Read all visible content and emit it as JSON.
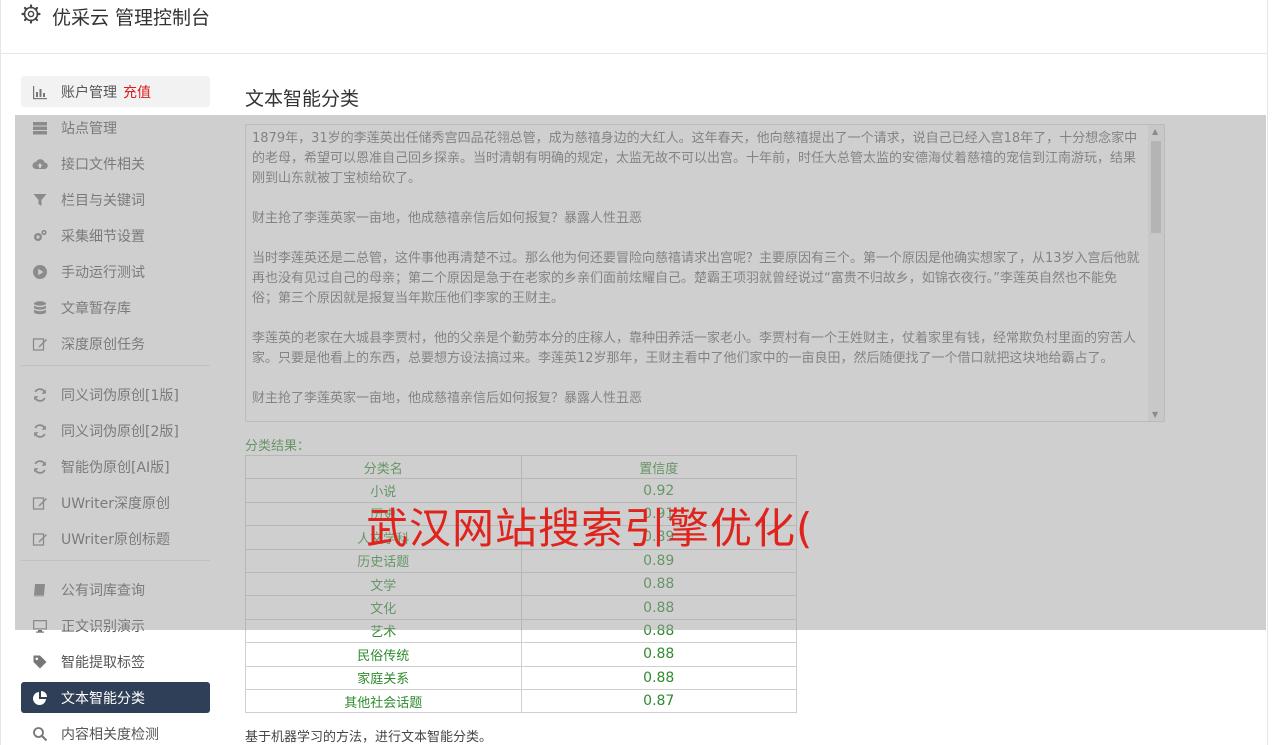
{
  "header": {
    "title": "优采云 管理控制台",
    "icon": "gear-icon"
  },
  "sidebar": {
    "group1": [
      {
        "label": "账户管理",
        "extra": "充值",
        "icon": "bar-chart-icon"
      },
      {
        "label": "站点管理",
        "icon": "server-icon"
      },
      {
        "label": "接口文件相关",
        "icon": "cloud-upload-icon"
      },
      {
        "label": "栏目与关键词",
        "icon": "filter-icon"
      },
      {
        "label": "采集细节设置",
        "icon": "cogs-icon"
      },
      {
        "label": "手动运行测试",
        "icon": "play-circle-icon"
      },
      {
        "label": "文章暂存库",
        "icon": "database-icon"
      },
      {
        "label": "深度原创任务",
        "icon": "edit-icon"
      }
    ],
    "group2": [
      {
        "label": "同义词伪原创[1版]",
        "icon": "refresh-icon"
      },
      {
        "label": "同义词伪原创[2版]",
        "icon": "refresh-icon"
      },
      {
        "label": "智能伪原创[AI版]",
        "icon": "refresh-icon"
      },
      {
        "label": "UWriter深度原创",
        "icon": "edit-icon"
      },
      {
        "label": "UWriter原创标题",
        "icon": "edit-icon"
      }
    ],
    "group3": [
      {
        "label": "公有词库查询",
        "icon": "book-icon"
      },
      {
        "label": "正文识别演示",
        "icon": "monitor-icon"
      },
      {
        "label": "智能提取标签",
        "icon": "tag-icon"
      },
      {
        "label": "文本智能分类",
        "icon": "pie-chart-icon"
      },
      {
        "label": "内容相关度检测",
        "icon": "search-icon"
      }
    ]
  },
  "main": {
    "title": "文本智能分类",
    "paragraphs": [
      "1879年，31岁的李莲英出任储秀宫四品花翎总管，成为慈禧身边的大红人。这年春天，他向慈禧提出了一个请求，说自己已经入宫18年了，十分想念家中的老母，希望可以恩准自己回乡探亲。当时清朝有明确的规定，太监无故不可以出宫。十年前，时任大总管太监的安德海仗着慈禧的宠信到江南游玩，结果刚到山东就被丁宝桢给砍了。",
      "财主抢了李莲英家一亩地，他成慈禧亲信后如何报复？暴露人性丑恶",
      "当时李莲英还是二总管，这件事他再清楚不过。那么他为何还要冒险向慈禧请求出宫呢？主要原因有三个。第一个原因是他确实想家了，从13岁入宫后他就再也没有见过自己的母亲；第二个原因是急于在老家的乡亲们面前炫耀自己。楚霸王项羽就曾经说过“富贵不归故乡，如锦衣夜行。”李莲英自然也不能免俗；第三个原因就是报复当年欺压他们李家的王财主。",
      "李莲英的老家在大城县李贾村，他的父亲是个勤劳本分的庄稼人，靠种田养活一家老小。李贾村有一个王姓财主，仗着家里有钱，经常欺负村里面的穷苦人家。只要是他看上的东西，总要想方设法搞过来。李莲英12岁那年，王财主看中了他们家中的一亩良田，然后随便找了一个借口就把这块地给霸占了。",
      "财主抢了李莲英家一亩地，他成慈禧亲信后如何报复？暴露人性丑恶"
    ],
    "result_label": "分类结果：",
    "table": {
      "headers": [
        "分类名",
        "置信度"
      ],
      "rows": [
        [
          "小说",
          "0.92"
        ],
        [
          "历史",
          "0.91"
        ],
        [
          "人文学科",
          "0.89"
        ],
        [
          "历史话题",
          "0.89"
        ],
        [
          "文学",
          "0.88"
        ],
        [
          "文化",
          "0.88"
        ],
        [
          "艺术",
          "0.88"
        ],
        [
          "民俗传统",
          "0.88"
        ],
        [
          "家庭关系",
          "0.88"
        ],
        [
          "其他社会话题",
          "0.87"
        ]
      ]
    },
    "note": "基于机器学习的方法，进行文本智能分类。"
  },
  "watermark": "武汉网站搜索引擎优化(",
  "colors": {
    "active_bg": "#2f3f57",
    "result_green": "#2e8b2e",
    "recharge_red": "#d9201e",
    "watermark_red": "#e0241d"
  }
}
